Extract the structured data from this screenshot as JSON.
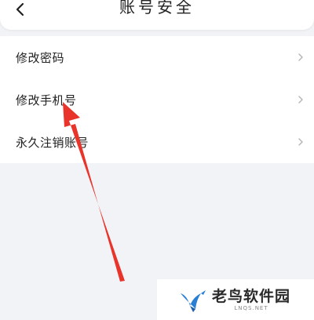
{
  "header": {
    "title": "账号安全",
    "back_icon": "chevron-left-icon"
  },
  "menu": {
    "items": [
      {
        "label": "修改密码"
      },
      {
        "label": "修改手机号"
      },
      {
        "label": "永久注销账号"
      }
    ],
    "chevron_icon": "chevron-right-icon"
  },
  "watermark": {
    "name": "老鸟软件园",
    "sub": "LNQS.NET"
  },
  "colors": {
    "background": "#f2f3f6",
    "surface": "#ffffff",
    "text": "#222222",
    "chevron": "#b5b5b5",
    "annotation_arrow": "#e8342a",
    "logo_blue": "#2a7fd4"
  }
}
